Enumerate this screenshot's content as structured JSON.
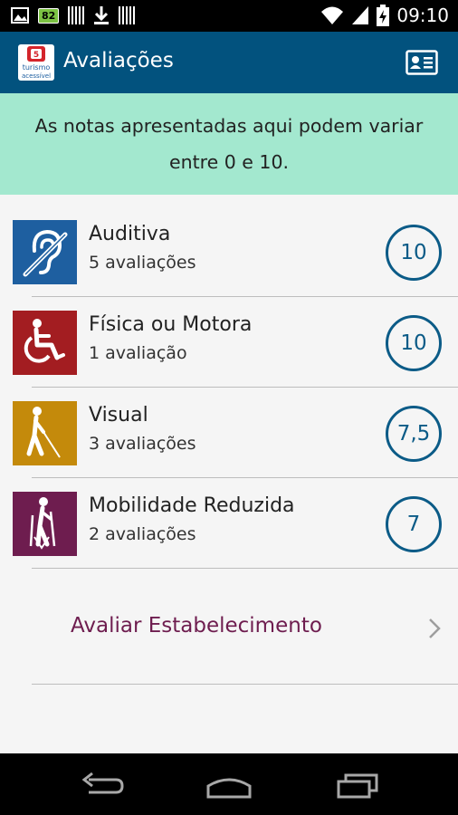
{
  "status_bar": {
    "notification_badge": "82",
    "time": "09:10",
    "icons": [
      "image-icon",
      "battery-badge-icon",
      "barcode-icon",
      "download-icon",
      "barcode-icon",
      "wifi-icon",
      "signal-icon",
      "battery-charging-icon"
    ]
  },
  "app_bar": {
    "title": "Avaliações",
    "logo_text_1": "turismo",
    "logo_text_2": "acessível",
    "logo_badge": "5",
    "action_icon": "id-card-icon"
  },
  "info": {
    "text": "As notas apresentadas aqui podem variar entre 0 e 10."
  },
  "ratings": [
    {
      "title": "Auditiva",
      "subtitle": "5 avaliações",
      "score": "10",
      "icon": "hearing-impaired-icon",
      "color": "#1e5fa0"
    },
    {
      "title": "Física ou Motora",
      "subtitle": "1 avaliação",
      "score": "10",
      "icon": "wheelchair-icon",
      "color": "#a31d21"
    },
    {
      "title": "Visual",
      "subtitle": "3 avaliações",
      "score": "7,5",
      "icon": "blind-person-icon",
      "color": "#c48a0b"
    },
    {
      "title": "Mobilidade Reduzida",
      "subtitle": "2 avaliações",
      "score": "7",
      "icon": "crutches-icon",
      "color": "#6e1d4f"
    }
  ],
  "action": {
    "label": "Avaliar Estabelecimento",
    "icon": "chevron-right-icon"
  },
  "colors": {
    "app_bar": "#02527e",
    "info_banner": "#a3e8cf",
    "score_ring": "#0b5b87",
    "action_text": "#6e1d4f"
  }
}
